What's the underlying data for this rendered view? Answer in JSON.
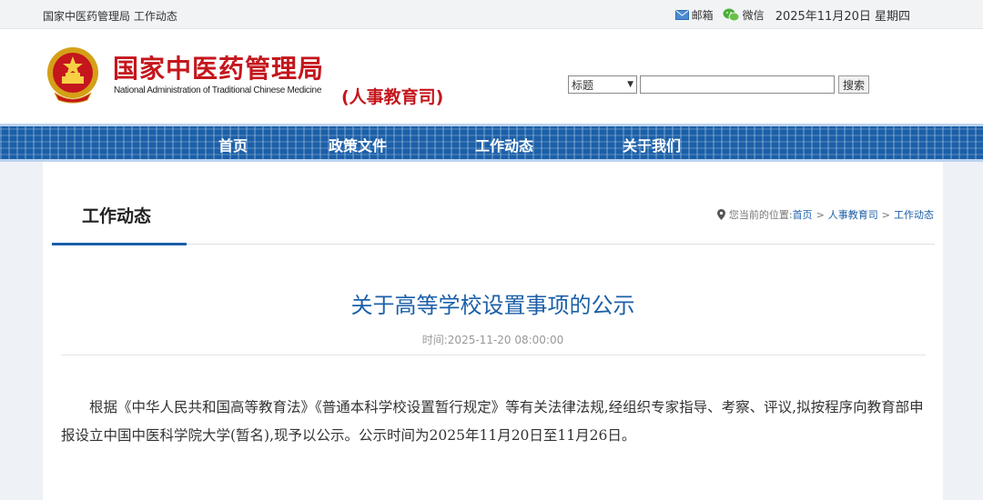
{
  "topbar": {
    "breadcrumb": "国家中医药管理局 工作动态",
    "mail": "邮箱",
    "wechat": "微信",
    "date": "2025年11月20日 星期四"
  },
  "header": {
    "logo_cn": "国家中医药管理局",
    "logo_en": "National Administration of Traditional Chinese Medicine",
    "department": "(人事教育司)",
    "search": {
      "selected_option": "标题",
      "value": "",
      "button": "搜索"
    }
  },
  "nav": {
    "items": [
      "首页",
      "政策文件",
      "工作动态",
      "关于我们"
    ]
  },
  "section": {
    "title": "工作动态",
    "location_label": "您当前的位置:",
    "location_path": [
      "首页",
      "人事教育司",
      "工作动态"
    ]
  },
  "article": {
    "title": "关于高等学校设置事项的公示",
    "time": "时间:2025-11-20 08:00:00",
    "body": "根据《中华人民共和国高等教育法》《普通本科学校设置暂行规定》等有关法律法规,经组织专家指导、考察、评议,拟按程序向教育部申报设立中国中医科学院大学(暂名),现予以公示。公示时间为2025年11月20日至11月26日。"
  },
  "colors": {
    "brand_red": "#c4161c",
    "brand_blue": "#1b5fa8"
  }
}
